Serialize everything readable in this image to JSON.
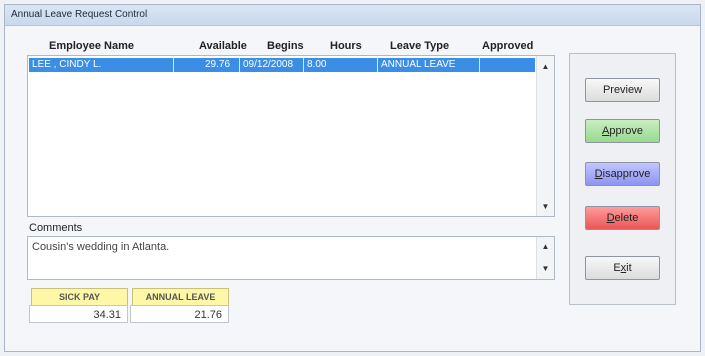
{
  "window": {
    "title": "Annual Leave Request Control"
  },
  "table": {
    "columns": [
      "Employee Name",
      "Available",
      "Begins",
      "Hours",
      "Leave Type",
      "Approved"
    ],
    "rows": [
      {
        "employee": "LEE , CINDY L.",
        "available": "29.76",
        "begins": "09/12/2008",
        "hours": "8.00",
        "leave_type": "ANNUAL LEAVE",
        "approved": ""
      }
    ]
  },
  "comments": {
    "label": "Comments",
    "text": "Cousin's wedding in Atlanta."
  },
  "balances": {
    "sick_pay": {
      "label": "SICK PAY",
      "value": "34.31"
    },
    "annual_leave": {
      "label": "ANNUAL LEAVE",
      "value": "21.76"
    }
  },
  "buttons": {
    "preview": "Preview",
    "approve_first": "A",
    "approve_rest": "pprove",
    "disapprove_first": "D",
    "disapprove_rest": "isapprove",
    "delete_first": "D",
    "delete_rest": "elete",
    "exit_pre": "E",
    "exit_mid": "x",
    "exit_post": "it"
  },
  "colors": {
    "selection": "#3a8ee6",
    "approve": "#97d98e",
    "disapprove": "#8d93f2",
    "delete": "#ea5656",
    "balance_header": "#fff7a8"
  },
  "icons": {
    "scroll_up": "arrow-up-icon",
    "scroll_down": "arrow-down-icon"
  }
}
